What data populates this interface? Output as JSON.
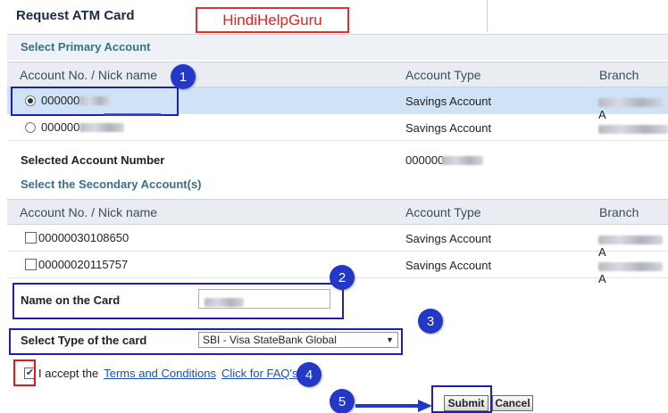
{
  "page": {
    "title": "Request ATM Card"
  },
  "watermark": "HindiHelpGuru",
  "primary": {
    "section_title": "Select Primary Account",
    "columns": [
      "Account No. / Nick name",
      "Account Type",
      "Branch"
    ],
    "rows": [
      {
        "account": "000000",
        "type": "Savings Account",
        "branch_suffix": "A",
        "selected": true
      },
      {
        "account": "000000",
        "type": "Savings Account",
        "branch_suffix": "",
        "selected": false
      }
    ],
    "selected_label": "Selected Account Number",
    "selected_value": "000000"
  },
  "secondary": {
    "section_title": "Select the Secondary Account(s)",
    "columns": [
      "Account No. / Nick name",
      "Account Type",
      "Branch"
    ],
    "rows": [
      {
        "account": "00000030108650",
        "type": "Savings Account",
        "branch_suffix": "A",
        "checked": false
      },
      {
        "account": "00000020115757",
        "type": "Savings Account",
        "branch_suffix": "A",
        "checked": false
      }
    ]
  },
  "form": {
    "name_label": "Name on the Card",
    "card_type_label": "Select Type of the card",
    "card_type_value": "SBI - Visa StateBank Global",
    "accept_prefix": "I accept the",
    "terms_link": "Terms and Conditions",
    "faq_link": "Click for FAQ's",
    "accept_checked": true
  },
  "buttons": {
    "submit": "Submit",
    "cancel": "Cancel"
  },
  "annotations": {
    "step1": "1",
    "step2": "2",
    "step3": "3",
    "step4": "4",
    "step5": "5"
  },
  "colors": {
    "annotation_blue": "#2438c8",
    "annotation_red": "#e01818",
    "watermark_red": "#e8201c"
  }
}
